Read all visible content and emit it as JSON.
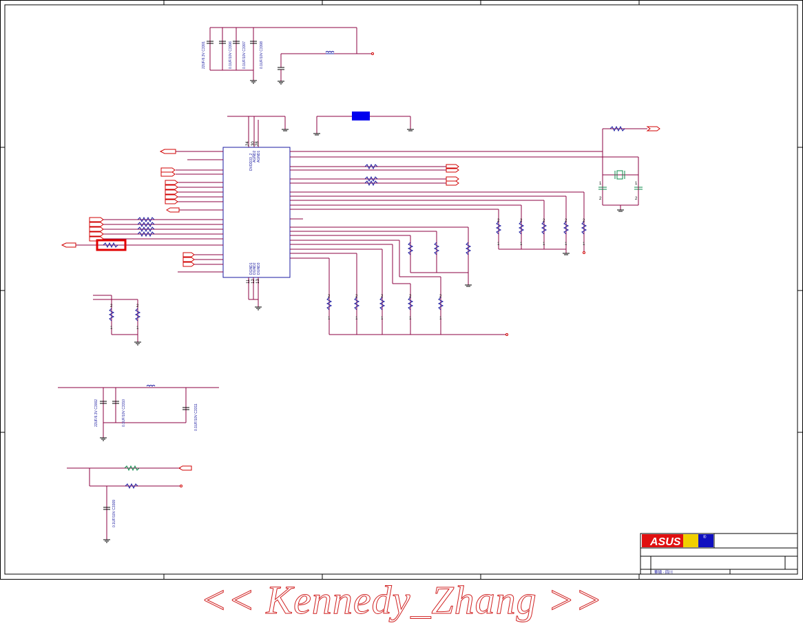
{
  "caps_top": [
    {
      "label": "22UF/6.3V",
      "ref": "C3301"
    },
    {
      "label": "0.1UF/10V",
      "ref": "C3306"
    },
    {
      "label": "0.1UF/10V",
      "ref": "C3307"
    },
    {
      "label": "0.1UF/10V",
      "ref": "C3308"
    }
  ],
  "caps_bottom": [
    {
      "label": "22UF/6.3V",
      "ref": "C3002"
    },
    {
      "label": "0.1UF/10V",
      "ref": "C3310"
    },
    {
      "label": "0.1UF/10V",
      "ref": "C3311"
    }
  ],
  "cap_lower": {
    "label": "0.1UF/10V",
    "ref": "C3309"
  },
  "ic": {
    "top_pins": [
      "24",
      "30",
      "28"
    ],
    "top_labels": [
      "DVDD33_2",
      "AGND2",
      "AGND1"
    ],
    "bottom_pins": [
      "11",
      "12",
      "13"
    ],
    "bottom_labels": [
      "DGND1",
      "DGND2",
      "DGND3"
    ]
  },
  "pin_numbers": {
    "one": "1",
    "two": "2"
  },
  "title_block": {
    "logo": "ASUS",
    "registered": "®",
    "footer_label": "華碩 - 四川"
  },
  "watermark": "<< Kennedy_Zhang >>",
  "colors": {
    "wire": "#8b0040",
    "net": "#d00000",
    "resistor": "#1a1aa0",
    "highlight": "#e00000"
  }
}
